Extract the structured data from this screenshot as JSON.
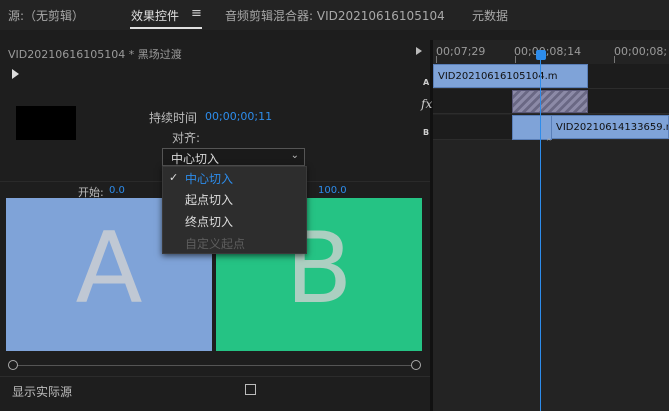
{
  "tabs": [
    {
      "label": "源:（无剪辑）"
    },
    {
      "label": "效果控件"
    },
    {
      "label": "音频剪辑混合器: VID20210616105104"
    },
    {
      "label": "元数据"
    }
  ],
  "tab_menu_icon": "hamburger-icon",
  "effect_controls": {
    "clip_header": "VID20210616105104 * 黑场过渡",
    "duration_label": "持续时间",
    "duration_value": "00;00;00;11",
    "alignment_label": "对齐:",
    "alignment_selected": "中心切入",
    "alignment_options": [
      "中心切入",
      "起点切入",
      "终点切入",
      "自定义起点"
    ],
    "start_label": "开始:",
    "start_value": "0.0",
    "end_value": "100.0",
    "preview_a": "A",
    "preview_b": "B",
    "show_actual_sources": "显示实际源"
  },
  "timeline": {
    "ticks": [
      "00;07;29",
      "00;00;08;14",
      "00;00;08;"
    ],
    "track_a": "A",
    "track_b": "B",
    "fx_badge": "fx",
    "clip_a": "VID20210616105104.m",
    "clip_b": "VID20210614133659.m"
  },
  "colors": {
    "accent": "#2d8ceb",
    "clip_a": "#7fa3d8",
    "clip_b": "#25c384"
  }
}
